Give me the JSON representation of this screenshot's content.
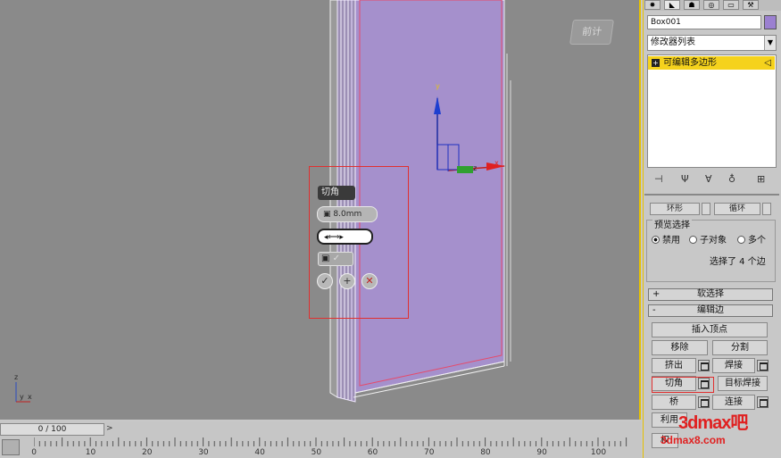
{
  "viewport": {
    "viewcube_label": "前计",
    "axis_y": "y",
    "axis_x": "x",
    "axis_z": "z",
    "corner_axis_z": "z",
    "corner_axis_x": "x",
    "corner_axis_y": "y"
  },
  "caddy": {
    "title": "切角",
    "amount": "8.0mm",
    "segments": "",
    "ok_icon": "check-icon",
    "apply_icon": "plus-icon",
    "cancel_icon": "close-icon"
  },
  "timeline": {
    "slider_label": "0 / 100",
    "left_arrow": "<",
    "right_arrow": ">",
    "ticks": [
      "0",
      "10",
      "20",
      "30",
      "40",
      "50",
      "60",
      "70",
      "80",
      "90",
      "100"
    ]
  },
  "panel": {
    "object_name": "Box001",
    "object_color": "#9b80d0",
    "modifier_list": "修改器列表",
    "stack_item": "可编辑多边形",
    "ring_label": "环形",
    "loop_label": "循环",
    "preview_label": "预览选择",
    "preview_options": [
      "禁用",
      "子对象",
      "多个"
    ],
    "selection_status": "选择了 4 个边",
    "soft_selection": "软选择",
    "edit_edges": "编辑边",
    "insert_vertex": "插入顶点",
    "remove": "移除",
    "split": "分割",
    "extrude": "挤出",
    "weld": "焊接",
    "chamfer": "切角",
    "target_weld": "目标焊接",
    "bridge": "桥",
    "connect": "连接",
    "use_selection": "利用",
    "weight": "权"
  },
  "watermark": {
    "main": "3dmax吧",
    "url": "3dmax8.com"
  },
  "colors": {
    "selection": "#f5d21c",
    "highlight": "#e03030",
    "object": "#a590cc"
  }
}
